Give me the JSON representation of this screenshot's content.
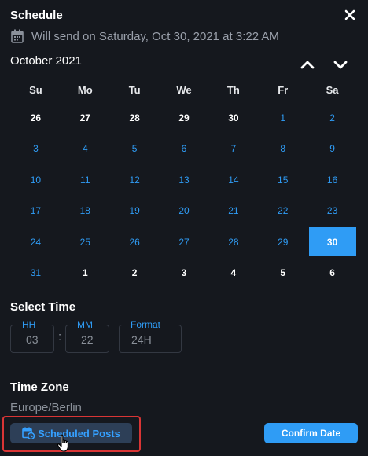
{
  "header": {
    "title": "Schedule",
    "send_info": "Will send on Saturday, Oct 30, 2021 at 3:22 AM"
  },
  "calendar": {
    "month_label": "October 2021",
    "weekdays": [
      "Su",
      "Mo",
      "Tu",
      "We",
      "Th",
      "Fr",
      "Sa"
    ],
    "weeks": [
      [
        {
          "d": "26",
          "t": "o"
        },
        {
          "d": "27",
          "t": "o"
        },
        {
          "d": "28",
          "t": "o"
        },
        {
          "d": "29",
          "t": "o"
        },
        {
          "d": "30",
          "t": "o"
        },
        {
          "d": "1",
          "t": "c"
        },
        {
          "d": "2",
          "t": "c"
        }
      ],
      [
        {
          "d": "3",
          "t": "c"
        },
        {
          "d": "4",
          "t": "c"
        },
        {
          "d": "5",
          "t": "c"
        },
        {
          "d": "6",
          "t": "c"
        },
        {
          "d": "7",
          "t": "c"
        },
        {
          "d": "8",
          "t": "c"
        },
        {
          "d": "9",
          "t": "c"
        }
      ],
      [
        {
          "d": "10",
          "t": "c"
        },
        {
          "d": "11",
          "t": "c"
        },
        {
          "d": "12",
          "t": "c"
        },
        {
          "d": "13",
          "t": "c"
        },
        {
          "d": "14",
          "t": "c"
        },
        {
          "d": "15",
          "t": "c"
        },
        {
          "d": "16",
          "t": "c"
        }
      ],
      [
        {
          "d": "17",
          "t": "c"
        },
        {
          "d": "18",
          "t": "c"
        },
        {
          "d": "19",
          "t": "c"
        },
        {
          "d": "20",
          "t": "c"
        },
        {
          "d": "21",
          "t": "c"
        },
        {
          "d": "22",
          "t": "c"
        },
        {
          "d": "23",
          "t": "c"
        }
      ],
      [
        {
          "d": "24",
          "t": "c"
        },
        {
          "d": "25",
          "t": "c"
        },
        {
          "d": "26",
          "t": "c"
        },
        {
          "d": "27",
          "t": "c"
        },
        {
          "d": "28",
          "t": "c"
        },
        {
          "d": "29",
          "t": "c"
        },
        {
          "d": "30",
          "t": "s"
        }
      ],
      [
        {
          "d": "31",
          "t": "c"
        },
        {
          "d": "1",
          "t": "o"
        },
        {
          "d": "2",
          "t": "o"
        },
        {
          "d": "3",
          "t": "o"
        },
        {
          "d": "4",
          "t": "o"
        },
        {
          "d": "5",
          "t": "o"
        },
        {
          "d": "6",
          "t": "o"
        }
      ]
    ]
  },
  "time": {
    "section_label": "Select Time",
    "hh_label": "HH",
    "hh_value": "03",
    "mm_label": "MM",
    "mm_value": "22",
    "format_label": "Format",
    "format_value": "24H",
    "separator": ":"
  },
  "timezone": {
    "section_label": "Time Zone",
    "value": "Europe/Berlin"
  },
  "footer": {
    "scheduled_posts_label": "Scheduled Posts",
    "confirm_label": "Confirm Date"
  },
  "colors": {
    "accent": "#2f9cf5",
    "background": "#15181e",
    "highlight_border": "#d93535"
  }
}
